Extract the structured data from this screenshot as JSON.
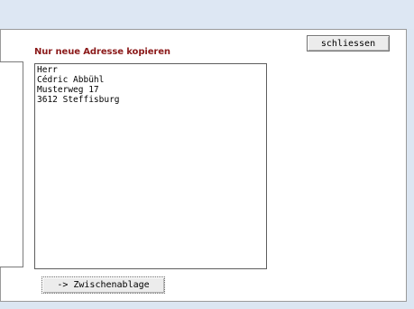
{
  "dialog": {
    "title": "Nur neue Adresse kopieren",
    "close_label": "schliessen",
    "clipboard_label": "-> Zwischenablage"
  },
  "address": {
    "lines": [
      "Herr",
      "Cédric Abbühl",
      "Musterweg 17",
      "3612 Steffisburg"
    ]
  }
}
